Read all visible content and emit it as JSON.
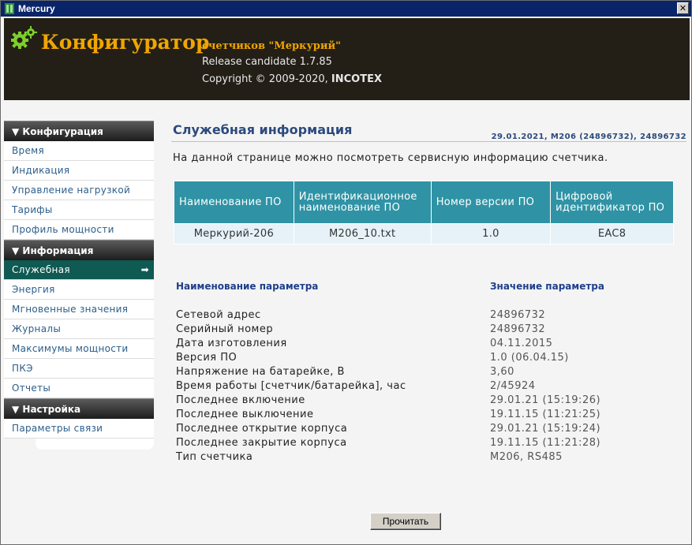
{
  "window": {
    "title": "Mercury",
    "close_glyph": "✕"
  },
  "header": {
    "brand": "Конфигуратор",
    "subtitle": "счетчиков \"Меркурий\"",
    "release": "Release candidate 1.7.85",
    "copyright_prefix": "Copyright © 2009-2020,",
    "company": "INCOTEX"
  },
  "sidebar": {
    "sections": [
      {
        "title": "▼ Конфигурация",
        "items": [
          "Время",
          "Индикация",
          "Управление нагрузкой",
          "Тарифы",
          "Профиль мощности"
        ]
      },
      {
        "title": "▼ Информация",
        "items": [
          "Служебная",
          "Энергия",
          "Мгновенные значения",
          "Журналы",
          "Максимумы мощности",
          "ПКЭ",
          "Отчеты"
        ]
      },
      {
        "title": "▼ Настройка",
        "items": [
          "Параметры связи"
        ]
      }
    ],
    "active_item": "Служебная",
    "active_arrow": "➡"
  },
  "main": {
    "title": "Служебная информация",
    "status": "29.01.2021, M206 (24896732), 24896732",
    "intro": "На данной странице можно посмотреть сервисную информацию счетчика.",
    "software_table": {
      "headers": [
        "Наименование ПО",
        "Идентификационное наименование ПО",
        "Номер версии ПО",
        "Цифровой идентификатор ПО"
      ],
      "row": [
        "Меркурий-206",
        "M206_10.txt",
        "1.0",
        "EAC8"
      ]
    },
    "params_header": {
      "name": "Наименование параметра",
      "value": "Значение параметра"
    },
    "params": [
      {
        "name": "Сетевой адрес",
        "value": "24896732"
      },
      {
        "name": "Серийный номер",
        "value": "24896732"
      },
      {
        "name": "Дата изготовления",
        "value": "04.11.2015"
      },
      {
        "name": "Версия ПО",
        "value": "1.0 (06.04.15)"
      },
      {
        "name": "Напряжение на батарейке, В",
        "value": "3,60"
      },
      {
        "name": "Время работы [счетчик/батарейка], час",
        "value": "2/45924"
      },
      {
        "name": "Последнее включение",
        "value": "29.01.21 (15:19:26)"
      },
      {
        "name": "Последнее выключение",
        "value": "19.11.15 (11:21:25)"
      },
      {
        "name": "Последнее открытие корпуса",
        "value": "29.01.21 (15:19:24)"
      },
      {
        "name": "Последнее закрытие корпуса",
        "value": "19.11.15 (11:21:28)"
      },
      {
        "name": "Тип счетчика",
        "value": "M206, RS485"
      }
    ],
    "read_button": "Прочитать"
  },
  "colors": {
    "titlebar": "#0a246a",
    "header_bg": "#231f17",
    "brand": "#f0a500",
    "table_header": "#2f93a5",
    "active_nav": "#0f5a53",
    "link": "#2c5e8a"
  },
  "icons": {
    "app": "mercury-app-icon",
    "logo": "gears-icon",
    "nav_arrow": "arrow-right-icon"
  }
}
